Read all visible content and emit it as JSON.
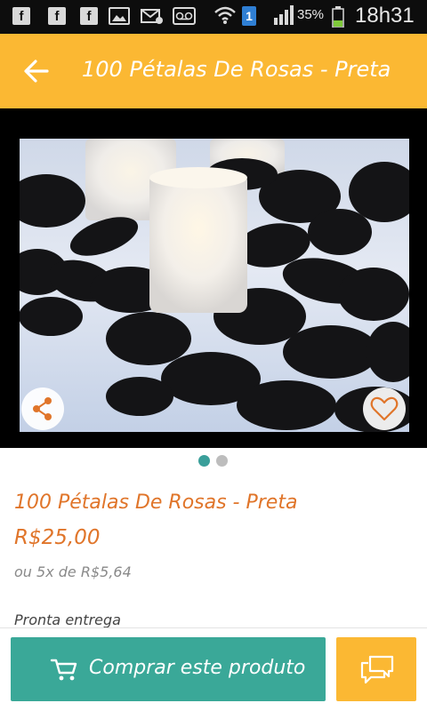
{
  "status_bar": {
    "icons": [
      "facebook-icon",
      "facebook-icon",
      "facebook-icon",
      "picture-icon",
      "mail-icon",
      "voicemail-icon",
      "wifi-icon",
      "sim-icon",
      "signal-icon",
      "battery-icon"
    ],
    "sim_number": "1",
    "fb_letter": "f",
    "battery_percent": "35%",
    "time": "18h31"
  },
  "app_bar": {
    "title": "100 Pétalas De Rosas - Preta",
    "color": "#fbb833"
  },
  "gallery": {
    "image_count": 2,
    "active_index": 0,
    "active_dot_color": "#3a9f9a",
    "inactive_dot_color": "#bdbdbd"
  },
  "product": {
    "title": "100 Pétalas De Rosas - Preta",
    "price": "R$25,00",
    "installments": "ou 5x de R$5,64",
    "availability": "Pronta entrega"
  },
  "actions": {
    "buy_label": "Comprar este produto",
    "buy_color": "#3aa898",
    "chat_color": "#fbb833"
  }
}
